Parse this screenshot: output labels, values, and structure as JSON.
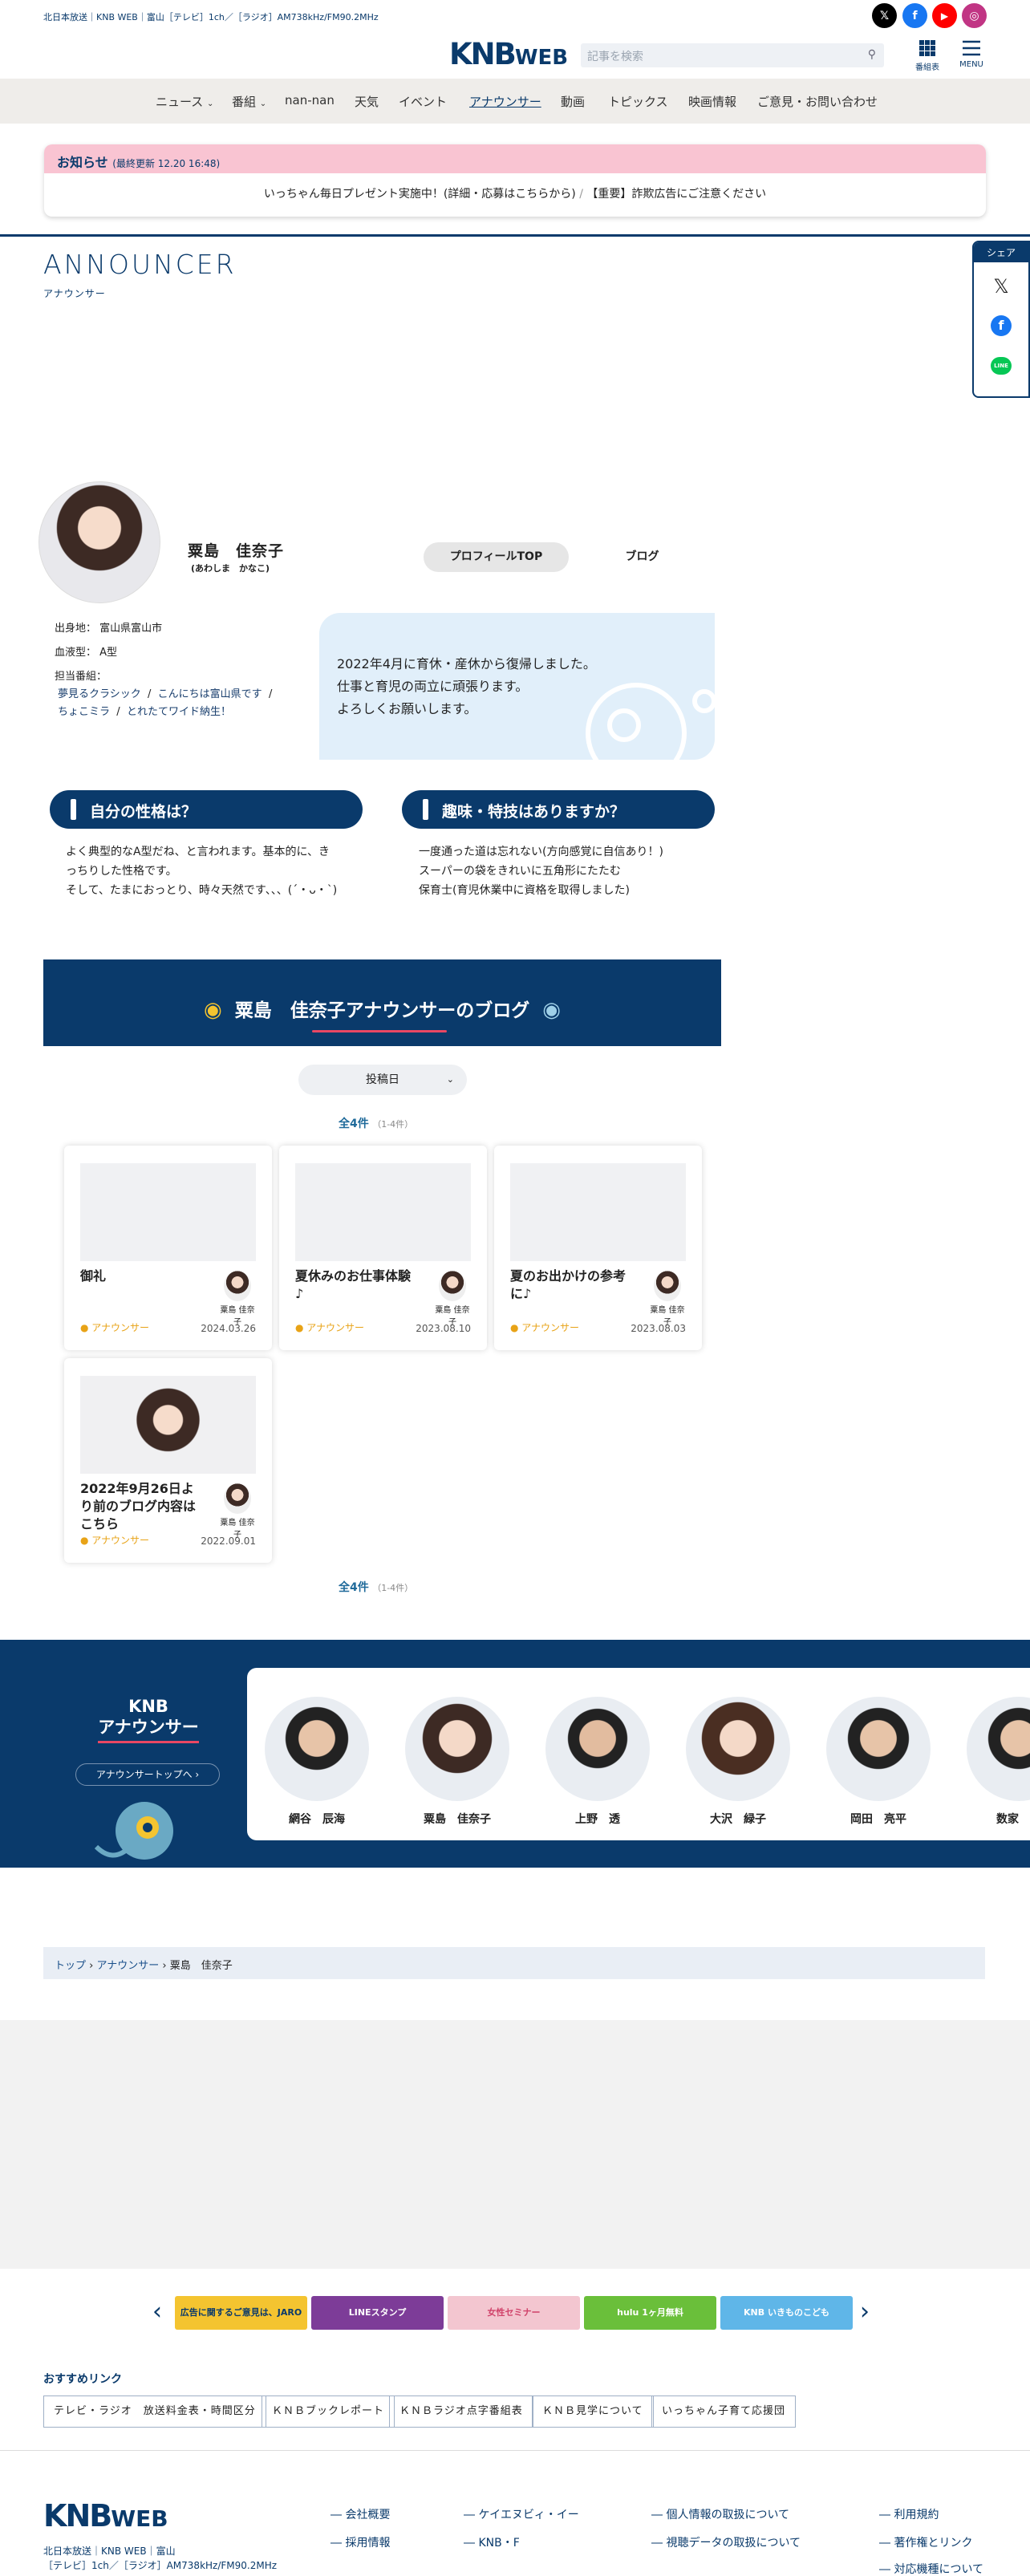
{
  "header": {
    "topline": "北日本放送｜KNB WEB｜富山［テレビ］1ch／［ラジオ］AM738kHz/FM90.2MHz",
    "logo_main": "KNB",
    "logo_sub": "WEB",
    "search_placeholder": "記事を検索",
    "program_table_label": "番組表",
    "menu_label": "MENU",
    "social": [
      {
        "name": "x-icon",
        "color": "#000000",
        "glyph": "𝕏"
      },
      {
        "name": "facebook-icon",
        "color": "#1877f2",
        "glyph": "f"
      },
      {
        "name": "youtube-icon",
        "color": "#ff0000",
        "glyph": "▶"
      },
      {
        "name": "instagram-icon",
        "color": "#c13584",
        "glyph": "◎"
      }
    ]
  },
  "nav": [
    "ニュース",
    "番組",
    "nan-nan",
    "天気",
    "イベント",
    "アナウンサー",
    "動画",
    "トピックス",
    "映画情報",
    "ご意見・お問い合わせ"
  ],
  "notice": {
    "title": "お知らせ",
    "updated": "(最終更新 12.20 16:48)",
    "link1": "いっちゃん毎日プレゼント実施中！(詳細・応募はこちらから)",
    "link2": "【重要】詐欺広告にご注意ください"
  },
  "page": {
    "title": "ANNOUNCER",
    "subtitle": "アナウンサー",
    "share": "シェア"
  },
  "profile": {
    "name": "粟島　佳奈子",
    "kana": "(あわしま　かなこ)",
    "btn_top": "プロフィールTOP",
    "btn_blog": "ブログ",
    "birthplace": "出身地： 富山県富山市",
    "blood": "血液型： A型",
    "programs_label": "担当番組：",
    "programs": [
      "夢見るクラシック",
      "こんにちは富山県です",
      "ちょこミラ",
      "とれたてワイド納生！"
    ],
    "message": [
      "2022年4月に育休・産休から復帰しました。",
      "仕事と育児の両立に頑張ります。",
      "よろしくお願いします。"
    ]
  },
  "qa": [
    {
      "q": "自分の性格は？",
      "a": [
        "よく典型的なA型だね、と言われます。基本的に、き",
        "っちりした性格です。",
        "そして、たまにおっとり、時々天然です、、、(´・ᴗ・`)"
      ]
    },
    {
      "q": "趣味・特技はありますか？",
      "a": [
        "一度通った道は忘れない(方向感覚に自信あり！)",
        "スーパーの袋をきれいに五角形にたたむ",
        "保育士(育児休業中に資格を取得しました)"
      ]
    }
  ],
  "blog": {
    "banner": "粟島　佳奈子アナウンサーのブログ",
    "sort_label": "投稿日",
    "count_text": "全4件",
    "count_range": "（1-4件）",
    "posts": [
      {
        "title": "御礼",
        "author": "粟島 佳奈子",
        "category": "アナウンサー",
        "date": "2024.03.26"
      },
      {
        "title": "夏休みのお仕事体験♪",
        "author": "粟島 佳奈子",
        "category": "アナウンサー",
        "date": "2023.08.10"
      },
      {
        "title": "夏のお出かけの参考に♪",
        "author": "粟島 佳奈子",
        "category": "アナウンサー",
        "date": "2023.08.03"
      },
      {
        "title": "2022年9月26日より前のブログ内容はこちら",
        "author": "粟島 佳奈子",
        "category": "アナウンサー",
        "date": "2022.09.01"
      }
    ]
  },
  "announcers": {
    "title1": "KNB",
    "title2": "アナウンサー",
    "button": "アナウンサートップへ ›",
    "members": [
      "網谷　辰海",
      "粟島　佳奈子",
      "上野　透",
      "大沢　緑子",
      "岡田　亮平",
      "数家　諒"
    ]
  },
  "breadcrumb": {
    "home": "トップ",
    "section": "アナウンサー",
    "current": "粟島　佳奈子"
  },
  "banners": [
    {
      "text": "広告に関するご意見は、JARO",
      "color": "#f4c430"
    },
    {
      "text": "LINEスタンプ",
      "color": "#7d3c98"
    },
    {
      "text": "女性セミナー",
      "color": "#f3c6d0"
    },
    {
      "text": "hulu 1ヶ月無料",
      "color": "#6abf3a"
    },
    {
      "text": "KNB いきものこども",
      "color": "#5fb6e8"
    }
  ],
  "recommend": {
    "title": "おすすめリンク",
    "links": [
      "テレビ・ラジオ　放送料金表・時間区分",
      "ＫＮＢブックレポート",
      "ＫＮＢラジオ点字番組表",
      "ＫＮＢ見学について",
      "いっちゃん子育て応援団"
    ]
  },
  "footer": {
    "info1": "北日本放送｜KNB WEB｜富山",
    "info2": "［テレビ］1ch／［ラジオ］AM738kHz/FM90.2MHz",
    "col1": [
      "会社概要",
      "採用情報"
    ],
    "col2": [
      "ケイエヌビィ・イー",
      "KNB・F"
    ],
    "col3": [
      "個人情報の取扱について",
      "視聴データの取扱について"
    ],
    "col4": [
      "利用規約",
      "著作権とリンク",
      "対応機種について"
    ]
  }
}
